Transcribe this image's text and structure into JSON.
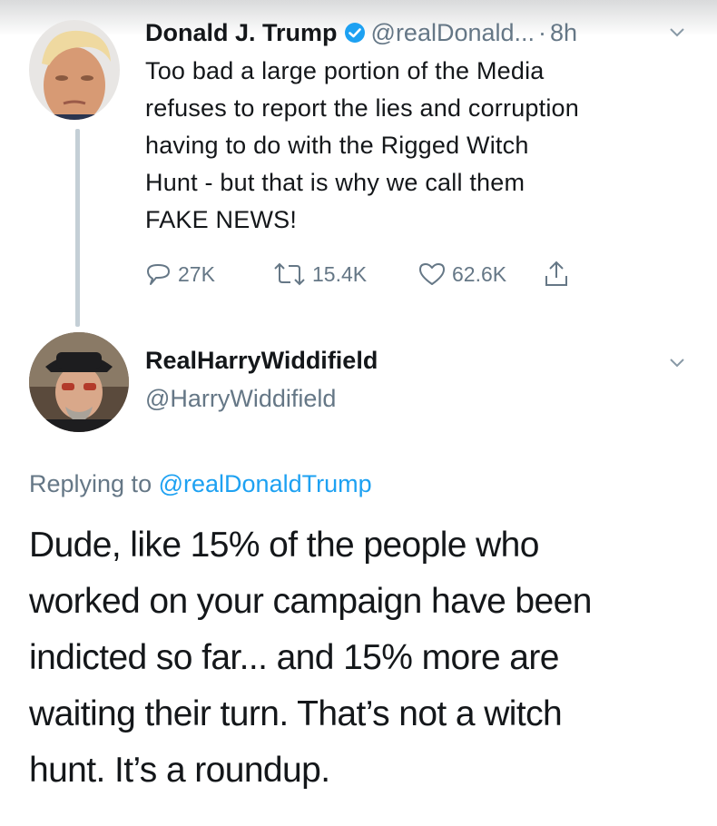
{
  "tweet": {
    "author_name": "Donald J. Trump",
    "handle": "@realDonald...",
    "separator": "·",
    "time": "8h",
    "lines": [
      "Too bad a large portion of the Media",
      "refuses to report the lies and corruption",
      "having to do with the Rigged Witch",
      "Hunt - but that is why we call them",
      "FAKE NEWS!"
    ],
    "reply_count": "27K",
    "retweet_count": "15.4K",
    "like_count": "62.6K",
    "icons": {
      "verified": "verified-badge-icon",
      "reply": "reply-bubble-icon",
      "retweet": "retweet-icon",
      "like": "heart-icon",
      "share": "share-icon",
      "menu": "chevron-down-icon"
    }
  },
  "reply": {
    "author_name": "RealHarryWiddifield",
    "handle": "@HarryWiddifield",
    "replying_prefix": "Replying to",
    "replying_to": "@realDonaldTrump",
    "lines": [
      "Dude, like 15% of the people who",
      "worked on your campaign have been",
      "indicted so far... and 15% more are",
      "waiting their turn. That’s not a witch",
      "hunt. It’s a roundup."
    ]
  },
  "colors": {
    "text_primary": "#14171a",
    "text_secondary": "#657786",
    "link": "#1da1f2",
    "verified": "#1da1f2",
    "thread_line": "#c4cfd6"
  }
}
